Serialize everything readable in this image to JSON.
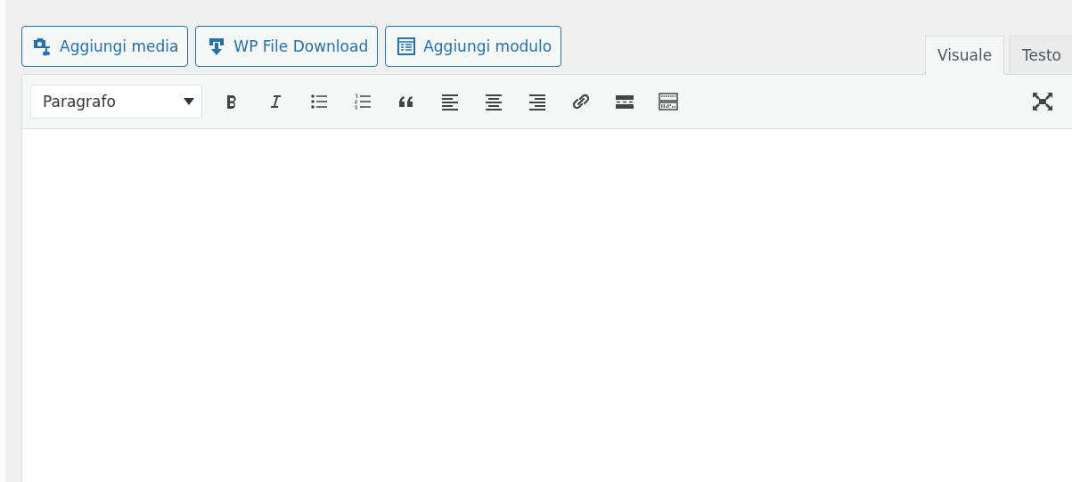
{
  "media_buttons": [
    {
      "label": "Aggiungi media",
      "kind": "media"
    },
    {
      "label": "WP File Download",
      "kind": "download"
    },
    {
      "label": "Aggiungi modulo",
      "kind": "form"
    }
  ],
  "tabs": [
    {
      "label": "Visuale",
      "selected": true
    },
    {
      "label": "Testo",
      "selected": false
    }
  ],
  "format_select": {
    "value": "Paragrafo"
  },
  "tools": [
    {
      "kind": "bold"
    },
    {
      "kind": "italic"
    },
    {
      "kind": "bullets"
    },
    {
      "kind": "numbers"
    },
    {
      "kind": "quote"
    },
    {
      "kind": "left"
    },
    {
      "kind": "center"
    },
    {
      "kind": "right"
    },
    {
      "kind": "link"
    },
    {
      "kind": "more"
    },
    {
      "kind": "kitchen"
    }
  ],
  "fullscreen": {
    "kind": "fullscreen"
  }
}
